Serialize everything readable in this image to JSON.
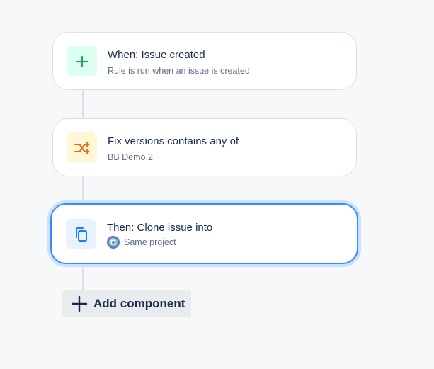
{
  "rule": {
    "components": [
      {
        "kind": "trigger",
        "title": "When: Issue created",
        "subtitle": "Rule is run when an issue is created.",
        "icon": "plus-icon",
        "icon_bg": "#dcfff1",
        "icon_color": "#22a06b"
      },
      {
        "kind": "condition",
        "title": "Fix versions contains any of",
        "subtitle": "BB Demo 2",
        "icon": "shuffle-icon",
        "icon_bg": "#fff7d6",
        "icon_color": "#e56910"
      },
      {
        "kind": "action",
        "title": "Then: Clone issue into",
        "subtitle": "Same project",
        "icon": "copy-icon",
        "icon_bg": "#e9f2ff",
        "icon_color": "#1d7afc",
        "selected": true
      }
    ],
    "add_component_label": "Add component"
  },
  "colors": {
    "selected_border": "#388bff",
    "selected_glow": "#cce0ff",
    "connector": "#dcdfe4",
    "background": "#f7f8f9"
  }
}
